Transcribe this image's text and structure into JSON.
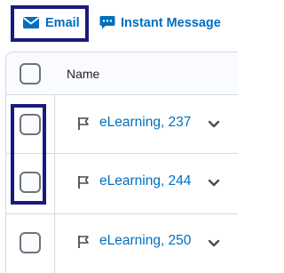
{
  "toolbar": {
    "email_label": "Email",
    "im_label": "Instant Message"
  },
  "table": {
    "header": {
      "name_label": "Name"
    },
    "rows": [
      {
        "name": "eLearning, 237"
      },
      {
        "name": "eLearning, 244"
      },
      {
        "name": "eLearning, 250"
      }
    ]
  },
  "colors": {
    "link": "#006fbf",
    "highlight": "#1a1a80",
    "border": "#d3d9e3"
  }
}
